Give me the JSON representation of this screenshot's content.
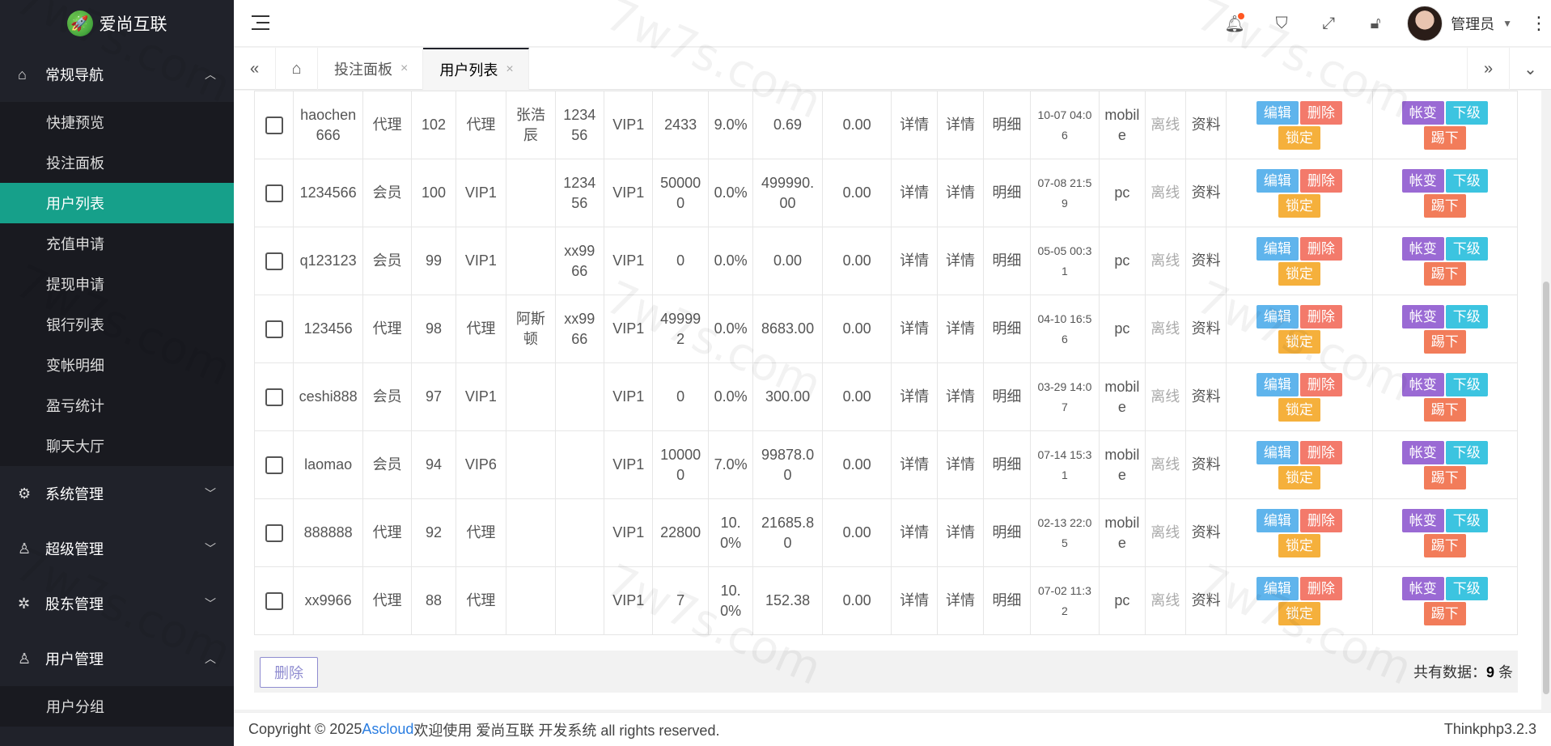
{
  "app": {
    "logo_text": "爱尚互联"
  },
  "sidebar": {
    "groups": [
      {
        "label": "常规导航",
        "arrow": "⌃",
        "items": [
          "快捷预览",
          "投注面板",
          "用户列表",
          "充值申请",
          "提现申请",
          "银行列表",
          "变帐明细",
          "盈亏统计",
          "聊天大厅"
        ]
      },
      {
        "label": "系统管理",
        "arrow": "⌄"
      },
      {
        "label": "超级管理",
        "arrow": "⌄"
      },
      {
        "label": "股东管理",
        "arrow": "⌄"
      },
      {
        "label": "用户管理",
        "arrow": "⌃",
        "items": [
          "用户分组"
        ]
      }
    ],
    "active_item": "用户列表"
  },
  "header": {
    "username": "管理员"
  },
  "tabs": [
    {
      "label": "投注面板",
      "active": false
    },
    {
      "label": "用户列表",
      "active": true
    }
  ],
  "table": {
    "rows": [
      {
        "account": "haochen666",
        "role": "代理",
        "id": "102",
        "level": "代理",
        "parent": "张浩辰",
        "pwd": "123456",
        "vip": "VIP1",
        "balance": "2433",
        "rate": "9.0%",
        "profit": "0.69",
        "frozen": "0.00",
        "d1": "详情",
        "d2": "详情",
        "d3": "明细",
        "time": "10-07 04:06",
        "device": "mobile",
        "status": "离线",
        "info": "资料"
      },
      {
        "account": "1234566",
        "role": "会员",
        "id": "100",
        "level": "VIP1",
        "parent": "",
        "pwd": "123456",
        "vip": "VIP1",
        "balance": "500000",
        "rate": "0.0%",
        "profit": "499990.00",
        "frozen": "0.00",
        "d1": "详情",
        "d2": "详情",
        "d3": "明细",
        "time": "07-08 21:59",
        "device": "pc",
        "status": "离线",
        "info": "资料"
      },
      {
        "account": "q123123",
        "role": "会员",
        "id": "99",
        "level": "VIP1",
        "parent": "",
        "pwd": "xx9966",
        "vip": "VIP1",
        "balance": "0",
        "rate": "0.0%",
        "profit": "0.00",
        "frozen": "0.00",
        "d1": "详情",
        "d2": "详情",
        "d3": "明细",
        "time": "05-05 00:31",
        "device": "pc",
        "status": "离线",
        "info": "资料"
      },
      {
        "account": "123456",
        "role": "代理",
        "id": "98",
        "level": "代理",
        "parent": "阿斯顿",
        "pwd": "xx9966",
        "vip": "VIP1",
        "balance": "499992",
        "rate": "0.0%",
        "profit": "8683.00",
        "frozen": "0.00",
        "d1": "详情",
        "d2": "详情",
        "d3": "明细",
        "time": "04-10 16:56",
        "device": "pc",
        "status": "离线",
        "info": "资料"
      },
      {
        "account": "ceshi888",
        "role": "会员",
        "id": "97",
        "level": "VIP1",
        "parent": "",
        "pwd": "",
        "vip": "VIP1",
        "balance": "0",
        "rate": "0.0%",
        "profit": "300.00",
        "frozen": "0.00",
        "d1": "详情",
        "d2": "详情",
        "d3": "明细",
        "time": "03-29 14:07",
        "device": "mobile",
        "status": "离线",
        "info": "资料"
      },
      {
        "account": "laomao",
        "role": "会员",
        "id": "94",
        "level": "VIP6",
        "parent": "",
        "pwd": "",
        "vip": "VIP1",
        "balance": "100000",
        "rate": "7.0%",
        "profit": "99878.00",
        "frozen": "0.00",
        "d1": "详情",
        "d2": "详情",
        "d3": "明细",
        "time": "07-14 15:31",
        "device": "mobile",
        "status": "离线",
        "info": "资料"
      },
      {
        "account": "888888",
        "role": "代理",
        "id": "92",
        "level": "代理",
        "parent": "",
        "pwd": "",
        "vip": "VIP1",
        "balance": "22800",
        "rate": "10.0%",
        "profit": "21685.80",
        "frozen": "0.00",
        "d1": "详情",
        "d2": "详情",
        "d3": "明细",
        "time": "02-13 22:05",
        "device": "mobile",
        "status": "离线",
        "info": "资料"
      },
      {
        "account": "xx9966",
        "role": "代理",
        "id": "88",
        "level": "代理",
        "parent": "",
        "pwd": "",
        "vip": "VIP1",
        "balance": "7",
        "rate": "10.0%",
        "profit": "152.38",
        "frozen": "0.00",
        "d1": "详情",
        "d2": "详情",
        "d3": "明细",
        "time": "07-02 11:32",
        "device": "pc",
        "status": "离线",
        "info": "资料"
      }
    ],
    "actions": {
      "edit": "编辑",
      "delete": "删除",
      "lock": "锁定",
      "transfer": "帐变",
      "sub": "下级",
      "kick": "踢下"
    }
  },
  "footer": {
    "delete_label": "删除",
    "total_prefix": "共有数据：",
    "total_count": "9",
    "total_suffix": " 条"
  },
  "copyright": {
    "prefix": "Copyright © 2025 ",
    "link": "Ascloud",
    "suffix": " 欢迎使用 爱尚互联 开发系统 all rights reserved.",
    "version": "Thinkphp3.2.3"
  },
  "watermark": "7w7s.com"
}
